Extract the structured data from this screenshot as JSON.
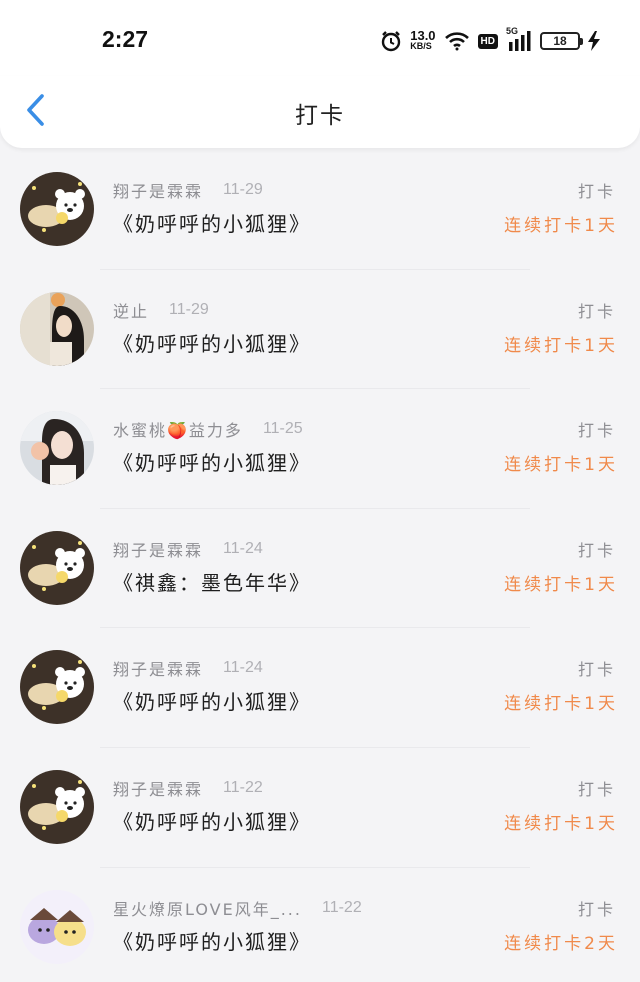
{
  "status_bar": {
    "time": "2:27",
    "speed_value": "13.0",
    "speed_unit": "KB/S",
    "hd_label": "HD",
    "network_label": "5G",
    "battery_level": "18",
    "icons": [
      "alarm-icon",
      "wifi-icon",
      "hd-icon",
      "signal-icon",
      "battery-icon",
      "charging-icon"
    ]
  },
  "nav": {
    "title": "打卡",
    "back_icon": "chevron-left-icon",
    "accent_color": "#3a8ee6"
  },
  "colors": {
    "streak": "#f08a4b",
    "meta": "#8e8e93"
  },
  "entries": [
    {
      "nickname": "翔子是霖霖",
      "date": "11-29",
      "work": "《奶呼呼的小狐狸》",
      "action": "打卡",
      "streak": "连续打卡1天",
      "avatar": "bear-avatar"
    },
    {
      "nickname": "逆止",
      "date": "11-29",
      "work": "《奶呼呼的小狐狸》",
      "action": "打卡",
      "streak": "连续打卡1天",
      "avatar": "girl-photo-avatar"
    },
    {
      "nickname": "水蜜桃🍑益力多",
      "date": "11-25",
      "work": "《奶呼呼的小狐狸》",
      "action": "打卡",
      "streak": "连续打卡1天",
      "avatar": "girl-selfie-avatar"
    },
    {
      "nickname": "翔子是霖霖",
      "date": "11-24",
      "work": "《祺鑫：墨色年华》",
      "action": "打卡",
      "streak": "连续打卡1天",
      "avatar": "bear-avatar"
    },
    {
      "nickname": "翔子是霖霖",
      "date": "11-24",
      "work": "《奶呼呼的小狐狸》",
      "action": "打卡",
      "streak": "连续打卡1天",
      "avatar": "bear-avatar"
    },
    {
      "nickname": "翔子是霖霖",
      "date": "11-22",
      "work": "《奶呼呼的小狐狸》",
      "action": "打卡",
      "streak": "连续打卡1天",
      "avatar": "bear-avatar"
    },
    {
      "nickname": "星火燎原LOVE风年_...",
      "date": "11-22",
      "work": "《奶呼呼的小狐狸》",
      "action": "打卡",
      "streak": "连续打卡2天",
      "avatar": "cartoon-pair-avatar"
    }
  ]
}
